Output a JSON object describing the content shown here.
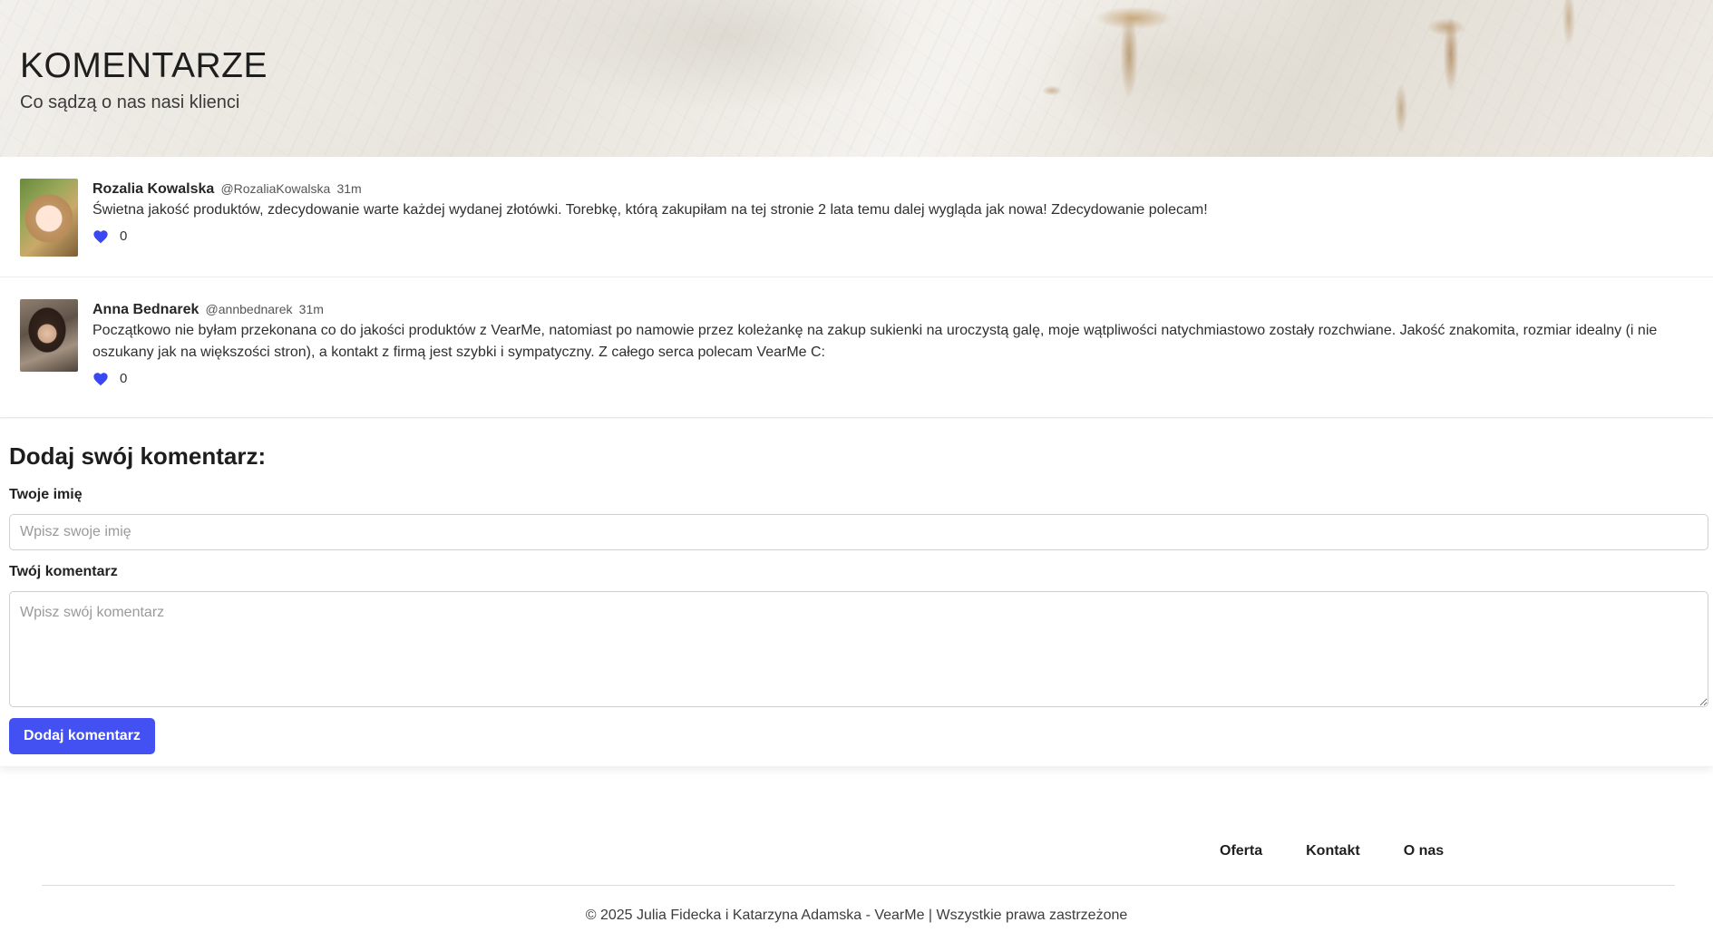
{
  "hero": {
    "title": "KOMENTARZE",
    "subtitle": "Co sądzą o nas nasi klienci"
  },
  "comments": [
    {
      "author": "Rozalia Kowalska",
      "handle": "@RozaliaKowalska",
      "time": "31m",
      "text": "Świetna jakość produktów, zdecydowanie warte każdej wydanej złotówki. Torebkę, którą zakupiłam na tej stronie 2 lata temu dalej wygląda jak nowa! Zdecydowanie polecam!",
      "likes": "0"
    },
    {
      "author": "Anna Bednarek",
      "handle": "@annbednarek",
      "time": "31m",
      "text": "Początkowo nie byłam przekonana co do jakości produktów z VearMe, natomiast po namowie przez koleżankę na zakup sukienki na uroczystą galę, moje wątpliwości natychmiastowo zostały rozchwiane. Jakość znakomita, rozmiar idealny (i nie oszukany jak na większości stron), a kontakt z firmą jest szybki i sympatyczny. Z całego serca polecam VearMe C:",
      "likes": "0"
    }
  ],
  "form": {
    "title": "Dodaj swój komentarz:",
    "name_label": "Twoje imię",
    "name_placeholder": "Wpisz swoje imię",
    "name_value": "",
    "comment_label": "Twój komentarz",
    "comment_placeholder": "Wpisz swój komentarz",
    "comment_value": "",
    "submit_label": "Dodaj komentarz"
  },
  "footer": {
    "links": [
      "Oferta",
      "Kontakt",
      "O nas"
    ],
    "copyright": "© 2025 Julia Fidecka i Katarzyna Adamska - VearMe | Wszystkie prawa zastrzeżone"
  },
  "colors": {
    "accent": "#4451f2",
    "heart": "#3b47f0"
  },
  "icons": {
    "like": "heart-icon"
  }
}
